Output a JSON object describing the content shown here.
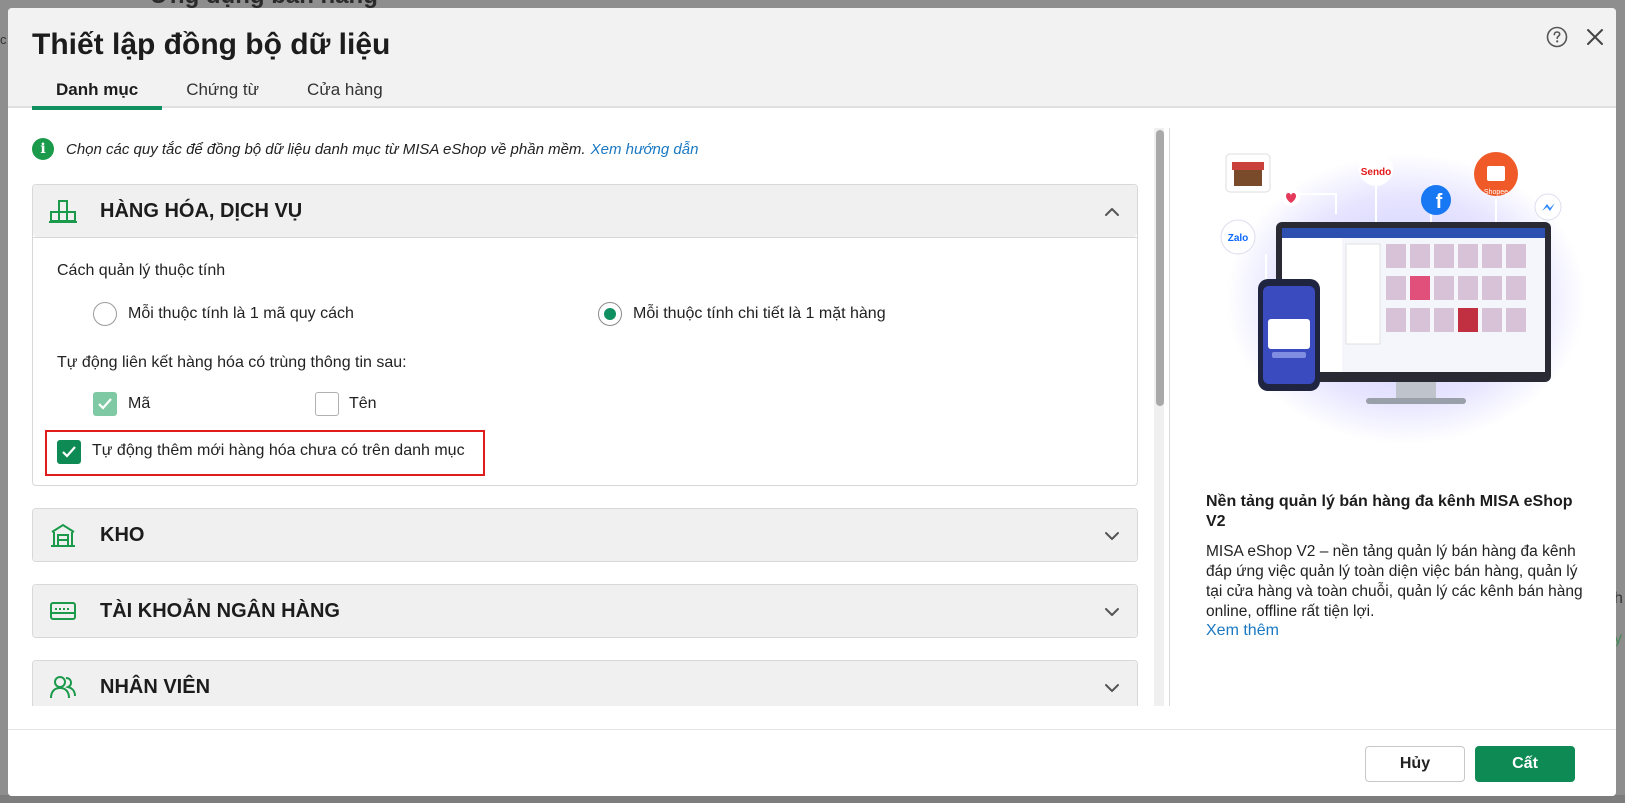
{
  "background": {
    "title": "Ứng dụng bán hàng",
    "left_char": "c",
    "right_text1": "h",
    "right_text2": "y"
  },
  "dialog": {
    "title": "Thiết lập đồng bộ dữ liệu",
    "tabs": [
      {
        "label": "Danh mục",
        "active": true
      },
      {
        "label": "Chứng từ",
        "active": false
      },
      {
        "label": "Cửa hàng",
        "active": false
      }
    ],
    "info": {
      "text": "Chọn các quy tắc để đồng bộ dữ liệu danh mục từ MISA eShop về phần mềm.",
      "link": "Xem hướng dẫn"
    },
    "sections": {
      "goods": {
        "title": "HÀNG HÓA, DỊCH VỤ",
        "attr_label": "Cách quản lý thuộc tính",
        "radio1": "Mỗi thuộc tính là 1 mã quy cách",
        "radio2": "Mỗi thuộc tính chi tiết là 1 mặt hàng",
        "selected_radio": 2,
        "autolink_label": "Tự động liên kết hàng hóa có trùng thông tin sau:",
        "cb_code": "Mã",
        "cb_name": "Tên",
        "cb_auto_add": "Tự động thêm mới hàng hóa chưa có trên danh mục"
      },
      "warehouse": {
        "title": "KHO"
      },
      "bank": {
        "title": "TÀI KHOẢN NGÂN HÀNG"
      },
      "staff": {
        "title": "NHÂN VIÊN"
      }
    },
    "promo": {
      "title": "Nền tảng quản lý bán hàng đa kênh MISA eShop V2",
      "description": "MISA eShop V2 – nền tảng quản lý bán hàng đa kênh đáp ứng việc quản lý toàn diện việc bán hàng, quản lý tại cửa hàng và toàn chuỗi, quản lý các kênh bán hàng online, offline rất tiện lợi.",
      "link": "Xem thêm",
      "illustration": {
        "zalo": "Zalo",
        "sendo": "Sendo",
        "shopee": "Shopee"
      }
    },
    "footer": {
      "cancel": "Hủy",
      "save": "Cất"
    },
    "colors": {
      "accent": "#0e8a55",
      "link": "#1a78c2",
      "highlight": "#e01b1b"
    }
  }
}
